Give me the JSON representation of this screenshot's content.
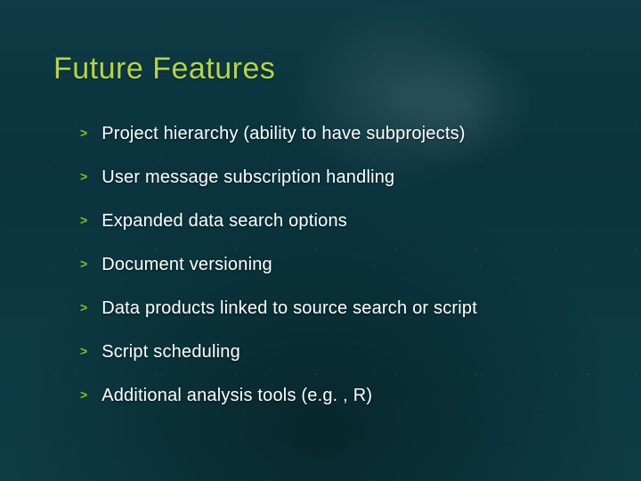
{
  "title": "Future Features",
  "bullets": [
    {
      "marker": ">",
      "text": "Project hierarchy (ability to have subprojects)"
    },
    {
      "marker": ">",
      "text": "User message subscription handling"
    },
    {
      "marker": ">",
      "text": "Expanded data search options"
    },
    {
      "marker": ">",
      "text": "Document versioning"
    },
    {
      "marker": ">",
      "text": "Data products linked to source search or script"
    },
    {
      "marker": ">",
      "text": "Script scheduling"
    },
    {
      "marker": ">",
      "text": "Additional analysis tools (e.g. , R)"
    }
  ]
}
